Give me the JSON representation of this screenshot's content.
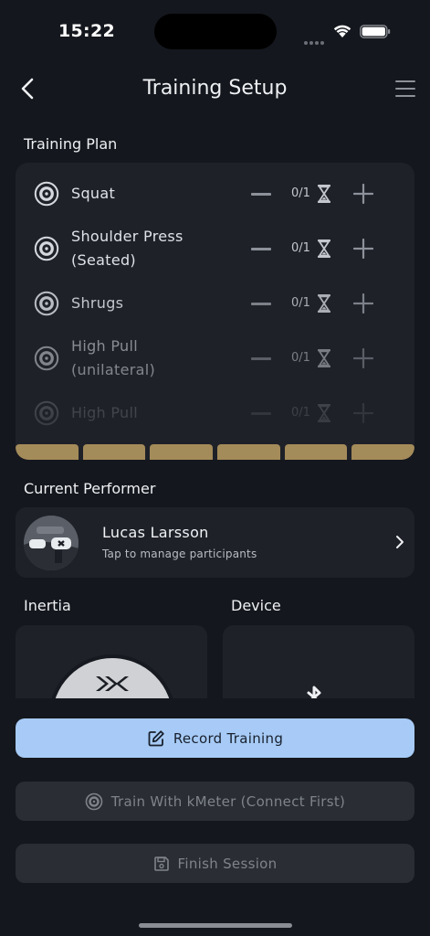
{
  "status_bar": {
    "time": "15:22"
  },
  "header": {
    "title": "Training Setup"
  },
  "plan": {
    "section_label": "Training Plan",
    "exercises": [
      {
        "name_line1": "Squat",
        "name_line2": "",
        "count": "0/1",
        "opacity": 1.0
      },
      {
        "name_line1": "Shoulder Press",
        "name_line2": "(Seated)",
        "count": "0/1",
        "opacity": 1.0
      },
      {
        "name_line1": "Shrugs",
        "name_line2": "",
        "count": "0/1",
        "opacity": 0.85
      },
      {
        "name_line1": "High Pull",
        "name_line2": "(unilateral)",
        "count": "0/1",
        "opacity": 0.55
      },
      {
        "name_line1": "High Pull",
        "name_line2": "",
        "count": "0/1",
        "opacity": 0.3
      }
    ],
    "weight_color": "#a48b5a"
  },
  "performer": {
    "section_label": "Current Performer",
    "name": "Lucas Larsson",
    "subtitle": "Tap to manage participants"
  },
  "inertia": {
    "section_label": "Inertia"
  },
  "device": {
    "section_label": "Device"
  },
  "actions": {
    "record_label": "Record Training",
    "train_label": "Train With kMeter (Connect First)",
    "finish_label": "Finish Session"
  },
  "colors": {
    "background": "#14171d",
    "card": "#1e2128",
    "primary_button": "#a7cbf6",
    "disabled_button": "#2a2d33"
  },
  "icons": {
    "back": "chevron-left-icon",
    "menu": "hamburger-menu-icon",
    "exercise": "weight-plate-icon",
    "timer": "hourglass-icon",
    "record": "edit-icon",
    "train": "weight-plate-icon",
    "finish": "save-icon",
    "device": "bluetooth-icon"
  }
}
